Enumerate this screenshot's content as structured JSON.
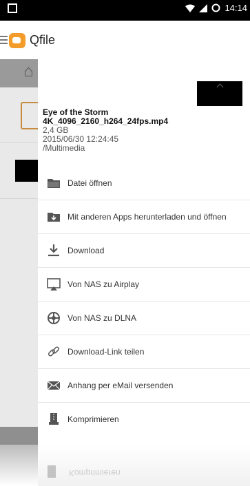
{
  "status_bar": {
    "time": "14:14"
  },
  "app": {
    "title": "Qfile"
  },
  "file": {
    "name_line1": "Eye of the Storm",
    "name_line2": "4K_4096_2160_h264_24fps.mp4",
    "size": "2,4 GB",
    "date": "2015/06/30 12:24:45",
    "path": "/Multimedia"
  },
  "menu": {
    "items": [
      {
        "label": "Datei öffnen",
        "icon": "folder-open-icon"
      },
      {
        "label": "Mit anderen Apps herunterladen und öffnen",
        "icon": "folder-download-icon"
      },
      {
        "label": "Download",
        "icon": "download-icon"
      },
      {
        "label": "Von NAS zu Airplay",
        "icon": "airplay-icon"
      },
      {
        "label": "Von NAS zu DLNA",
        "icon": "dlna-icon"
      },
      {
        "label": "Download-Link teilen",
        "icon": "link-icon"
      },
      {
        "label": "Anhang per eMail versenden",
        "icon": "mail-icon"
      },
      {
        "label": "Komprimieren",
        "icon": "compress-icon"
      }
    ]
  },
  "reflection": {
    "label": "Komprimieren"
  },
  "colors": {
    "accent": "#f39c2a",
    "icon": "#555555",
    "status_bar": "#000000"
  }
}
